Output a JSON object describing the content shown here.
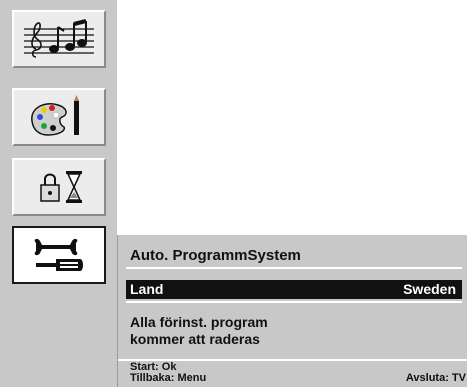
{
  "sidebar": {
    "items": [
      {
        "icon": "music-icon",
        "selected": false
      },
      {
        "icon": "palette-icon",
        "selected": false
      },
      {
        "icon": "lock-timer-icon",
        "selected": false
      },
      {
        "icon": "tools-icon",
        "selected": true
      }
    ]
  },
  "dialog": {
    "title": "Auto. ProgrammSystem",
    "setting_label": "Land",
    "setting_value": "Sweden",
    "message_line1": "Alla förinst. program",
    "message_line2": "kommer att raderas"
  },
  "footer": {
    "start": "Start: Ok",
    "back": "Tillbaka: Menu",
    "exit": "Avsluta: TV"
  },
  "colors": {
    "background": "#ffffff",
    "panel": "#c8c8c8",
    "selection": "#111111"
  }
}
